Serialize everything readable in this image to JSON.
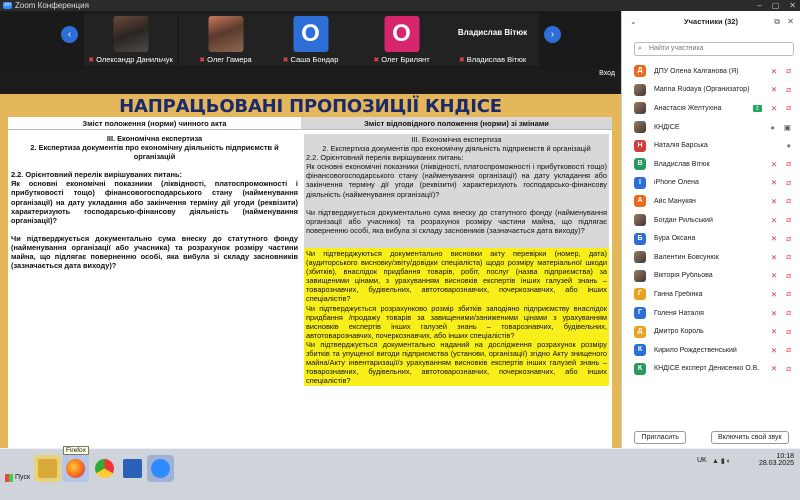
{
  "window": {
    "title": "Zoom Конференция",
    "app_badge": "zm"
  },
  "filmstrip": {
    "prev_arrow": "‹",
    "next_arrow": "›",
    "tiles": [
      {
        "name": "Олександр Данильчук",
        "initial": "",
        "bg": "photo",
        "big_name": ""
      },
      {
        "name": "Олег Гамера",
        "initial": "",
        "bg": "photo2",
        "big_name": ""
      },
      {
        "name": "Саша Бондар",
        "initial": "О",
        "bg": "#2d6fd6",
        "big_name": ""
      },
      {
        "name": "Олег Брилянт",
        "initial": "О",
        "bg": "#d7266b",
        "big_name": ""
      },
      {
        "name": "Владислав Вітюк",
        "initial": "",
        "bg": "",
        "big_name": "Владислав Вітюк"
      }
    ],
    "exit_label": "Вход"
  },
  "slide": {
    "title": "НАПРАЦЬОВАНІ ПРОПОЗИЦІЇ КНДІСЕ",
    "left_header": "Зміст положення (норми) чинного акта",
    "right_header": "Зміст відповідного положення (норми) зі змінами",
    "left": {
      "section": "ІІІ. Економічна експертиза",
      "subsection": "2. Експертиза документів про економічну діяльність підприємств й організацій",
      "item": "2.2. Орієнтовний перелік вирішуваних питань:",
      "q1": "Як основні економічні показники (ліквідності, платоспроможності і прибутковості тощо) фінансовогосподарського стану (найменування організації) на дату укладання або закінчення терміну дії угоди (реквізити) характеризують господарсько-фінансову діяльність (найменування організації)?",
      "q2": "Чи підтверджується документально сума внеску до статутного фонду (найменування організації або учасника) та розрахунок розміру частини майна, що підлягає поверненню особі, яка вибула зі складу засновників (зазначається дата виходу)?"
    },
    "right": {
      "section": "ІІІ. Економічна експертиза",
      "subsection": "2. Експертиза документів про економічну діяльність підприємств й організацій",
      "item": "2.2. Орієнтовний перелік вирішуваних питань:",
      "q1": "Як основні економічні показники (ліквідності, платоспроможності і прибутковості тощо) фінансовогосподарського стану (найменування організації) на дату укладання або закінчення терміну дії угоди (реквізити) характеризують господарсько-фінансову діяльність (найменування організації)?",
      "q2": "Чи підтверджується документально сума внеску до статутного фонду (найменування організації або учасника) та розрахунок розміру частини майна, що підлягає поверненню особі, яка вибула зі складу засновників (зазначається дата виходу)?",
      "y1": "Чи підтверджуються документально висновки акту перевірки (номер, дата) (аудиторського висновку/звіту/довідки спеціаліста) щодо розміру матеріальної шкоди (збитків), внаслідок придбання товарів, робіт, послуг (назва підприємства) за завищеними цінами, з урахуванням висновків експертів інших галузей знань – товарознавчих, будівельних, автотоварознавчих, почеркознавчих, або інших спеціалістів?",
      "y2": "Чи підтверджується розрахунково розмір збитків заподіяно підприємству внаслідок придбання /продажу товарів за завищеними/заниженими цінами з урахуванням висновків експертів інших галузей знань – товарознавчих, будівельних, автотоварознавчих, почеркознавчих, або інших спеціалістів?",
      "y3": "Чи підтверджується документально наданий на дослідження розрахунок розміру збитків та упущеної вигоди підприємства (установи, організації) згідно Акту знищеного майна/Акту інвентаризації/з урахуванням висновків експертів інших галузей знань – товарознавчих, будівельних, автотоварознавчих, почеркознавчих, або інших спеціалістів?"
    }
  },
  "participants": {
    "header": "Участники (32)",
    "search_placeholder": "Найти участника",
    "list": [
      {
        "name": "ДПУ Олена Калганова (Я)",
        "initial": "Д",
        "color": "#e8691f",
        "mic": "muted",
        "cam": "off"
      },
      {
        "name": "Marina Rudaya (Организатор)",
        "initial": "",
        "color": "photo",
        "mic": "muted",
        "cam": "off"
      },
      {
        "name": "Анастасія Желтухіна",
        "initial": "",
        "color": "photo",
        "mic": "muted",
        "cam": "off",
        "share": true
      },
      {
        "name": "КНДІСЕ",
        "initial": "",
        "color": "photo",
        "mic": "unmuted",
        "cam": "on"
      },
      {
        "name": "Наталія Барська",
        "initial": "Н",
        "color": "#d63a3a",
        "mic": "unmuted",
        "cam": ""
      },
      {
        "name": "Владислав Вітюк",
        "initial": "В",
        "color": "#2a9a5c",
        "mic": "muted",
        "cam": "off"
      },
      {
        "name": "iPhone Олена",
        "initial": "I",
        "color": "#2d6fd6",
        "mic": "muted",
        "cam": "off"
      },
      {
        "name": "Айс Манукян",
        "initial": "А",
        "color": "#e8691f",
        "mic": "muted",
        "cam": "off"
      },
      {
        "name": "Богдан Рильський",
        "initial": "",
        "color": "photo",
        "mic": "muted",
        "cam": "off"
      },
      {
        "name": "Бура Оксана",
        "initial": "Б",
        "color": "#2d6fd6",
        "mic": "muted",
        "cam": "off"
      },
      {
        "name": "Валентин Бовсунюк",
        "initial": "",
        "color": "photo",
        "mic": "muted",
        "cam": "off"
      },
      {
        "name": "Вікторія Рубльова",
        "initial": "",
        "color": "photo",
        "mic": "muted",
        "cam": "off"
      },
      {
        "name": "Ганна Гребінка",
        "initial": "Г",
        "color": "#e8a21f",
        "mic": "muted",
        "cam": "off"
      },
      {
        "name": "Голеня Наталія",
        "initial": "Г",
        "color": "#2d6fd6",
        "mic": "muted",
        "cam": "off"
      },
      {
        "name": "Дмитро Король",
        "initial": "Д",
        "color": "#e8a21f",
        "mic": "muted",
        "cam": "off"
      },
      {
        "name": "Кирило Рождественський",
        "initial": "К",
        "color": "#2d6fd6",
        "mic": "muted",
        "cam": "off"
      },
      {
        "name": "КНДІСЕ експерт Денисенко О.В.",
        "initial": "К",
        "color": "#2a9a5c",
        "mic": "muted",
        "cam": "off"
      }
    ],
    "invite_label": "Пригласить",
    "unmute_label": "Включить свой звук"
  },
  "taskbar": {
    "start_label": "Пуск",
    "tooltip": "Firefox",
    "lang": "UK",
    "time": "10:18",
    "date": "28.03.2025"
  },
  "colors": {
    "slide_bg": "#e3b75a",
    "title_color": "#1a2a6a",
    "highlight_yellow": "#f8ef1a",
    "zoom_blue": "#2d6fd6",
    "muted_red": "#e03434"
  }
}
